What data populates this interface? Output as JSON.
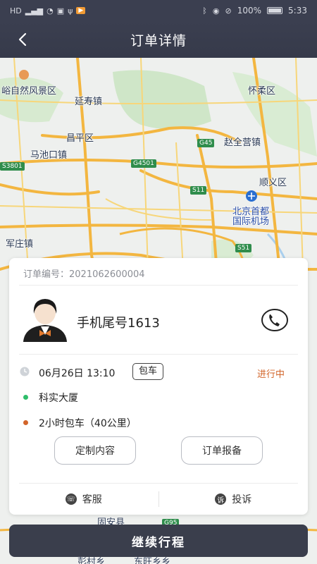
{
  "status_bar": {
    "left_icons": [
      "HD",
      "signal-icon",
      "wifi-icon",
      "notification-icon",
      "usb-icon",
      "app-badge-icon"
    ],
    "battery": "100%",
    "time": "5:33"
  },
  "header": {
    "title": "订单详情",
    "back_icon": "chevron-left-icon"
  },
  "map": {
    "labels": [
      "峪自然风景区",
      "延寿镇",
      "怀柔区",
      "昌平区",
      "赵全营镇",
      "马池口镇",
      "顺义区",
      "北京首都",
      "国际机场",
      "军庄镇",
      "固安县",
      "彭村乡",
      "东旺乡乡"
    ],
    "shields": [
      "G45",
      "G4501",
      "S3801",
      "S11",
      "S51",
      "G95"
    ]
  },
  "order": {
    "order_number_label": "订单编号：",
    "order_number": "2021062600004",
    "driver_label": "手机尾号1613",
    "datetime": "06月26日 13:10",
    "type_tag": "包车",
    "status": "进行中",
    "pickup": "科实大厦",
    "package": "2小时包车（40公里）"
  },
  "buttons": {
    "custom_content": "定制内容",
    "order_report": "订单报备",
    "customer_service": "客服",
    "complaint": "投诉",
    "continue": "继续行程"
  },
  "colors": {
    "header_bg": "#3b3f50",
    "status_orange": "#d2652a",
    "pickup_dot": "#2ebd6a",
    "continue_bg": "#3a3e4c"
  }
}
